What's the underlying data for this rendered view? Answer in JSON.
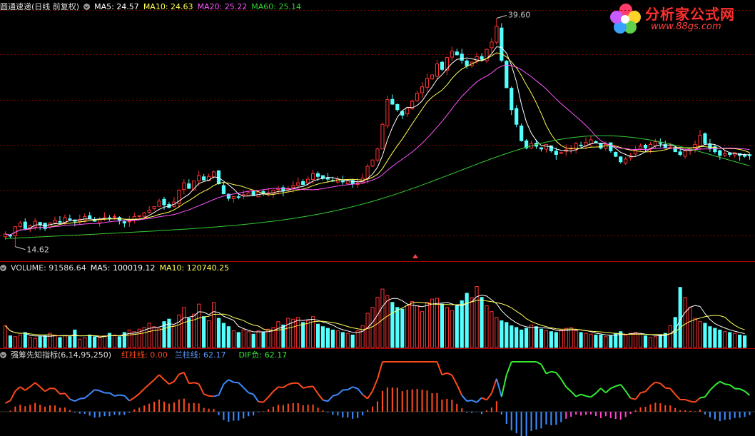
{
  "header": {
    "stock_title": "圆通速递(日线 前复权)",
    "ma5": "MA5: 24.57",
    "ma10": "MA10: 24.63",
    "ma20": "MA20: 25.22",
    "ma60": "MA60: 25.14"
  },
  "volume_header": {
    "volume": "VOLUME: 91586.64",
    "ma5": "MA5: 100019.12",
    "ma10": "MA10: 120740.25"
  },
  "indicator_header": {
    "name": "强筹先知指标(6,14,95,250)",
    "red": "红柱线: 0.00",
    "blue": "兰柱线: 62.17",
    "dif": "DIF负: 62.17"
  },
  "logo": {
    "title": "分析家公式网",
    "url": "www.88gs.com"
  },
  "annotations": {
    "high": "39.60",
    "low": "14.62"
  },
  "colors": {
    "up": "#ff3232",
    "down": "#54ffff",
    "ma5": "#ffffff",
    "ma10": "#ffff55",
    "ma20": "#ff55ff",
    "ma60": "#33cc33",
    "grid": "#8b0000",
    "ind_red": "#ff4a1c",
    "ind_blue": "#3c8cff",
    "ind_green": "#33ee33",
    "ind_pink": "#ff44cc"
  },
  "chart_data": [
    {
      "type": "candlestick",
      "title": "圆通速递(日线 前复权)",
      "price_range": [
        13.5,
        40.5
      ],
      "annotations": [
        {
          "label": "39.60",
          "value": 39.6
        },
        {
          "label": "14.62",
          "value": 14.62
        }
      ],
      "close": [
        16.0,
        15.8,
        16.8,
        17.2,
        16.6,
        16.9,
        17.4,
        17.0,
        16.6,
        17.2,
        17.5,
        17.3,
        17.8,
        17.6,
        17.4,
        17.6,
        17.9,
        17.7,
        17.4,
        17.6,
        17.8,
        17.7,
        17.9,
        17.5,
        17.2,
        17.4,
        17.9,
        18.0,
        18.3,
        18.6,
        19.0,
        19.6,
        19.2,
        18.9,
        19.5,
        20.8,
        21.6,
        21.0,
        21.8,
        22.4,
        21.9,
        22.3,
        22.8,
        21.5,
        20.4,
        19.9,
        20.1,
        20.0,
        20.3,
        20.5,
        20.2,
        20.6,
        20.4,
        20.5,
        20.8,
        21.0,
        20.7,
        21.0,
        21.3,
        21.6,
        21.4,
        22.0,
        22.6,
        22.3,
        22.1,
        22.0,
        21.8,
        22.0,
        21.7,
        21.8,
        21.5,
        21.6,
        22.1,
        23.4,
        24.1,
        25.3,
        28.0,
        30.7,
        30.2,
        29.6,
        29.0,
        29.8,
        30.5,
        31.4,
        32.1,
        33.0,
        33.4,
        34.6,
        34.0,
        35.3,
        36.0,
        35.6,
        35.0,
        34.4,
        34.8,
        35.4,
        35.1,
        36.2,
        37.0,
        38.7,
        35.0,
        32.0,
        29.6,
        28.0,
        26.2,
        25.4,
        25.9,
        25.6,
        25.3,
        25.8,
        25.1,
        24.7,
        24.9,
        25.2,
        25.4,
        25.9,
        25.7,
        26.0,
        26.3,
        26.0,
        25.4,
        25.8,
        25.1,
        24.5,
        23.9,
        24.2,
        24.6,
        25.2,
        25.6,
        25.4,
        25.8,
        26.1,
        25.9,
        25.4,
        25.5,
        25.0,
        24.7,
        25.1,
        25.4,
        25.8,
        26.8,
        25.9,
        25.4,
        25.0,
        24.6,
        24.8,
        24.7,
        24.9,
        24.6,
        24.5,
        24.57
      ]
    },
    {
      "type": "bar",
      "title": "VOLUME",
      "volume_range": [
        0,
        176000
      ],
      "values": [
        52000,
        28000,
        26000,
        30000,
        36000,
        24000,
        22000,
        26000,
        28000,
        34000,
        30000,
        24000,
        28000,
        26000,
        42000,
        20000,
        24000,
        30000,
        26000,
        24000,
        28000,
        34000,
        30000,
        26000,
        36000,
        42000,
        38000,
        44000,
        48000,
        58000,
        50000,
        46000,
        62000,
        68000,
        52000,
        78000,
        96000,
        70000,
        80000,
        104000,
        74000,
        64000,
        108000,
        70000,
        58000,
        50000,
        40000,
        36000,
        42000,
        38000,
        32000,
        40000,
        36000,
        44000,
        48000,
        62000,
        54000,
        70000,
        68000,
        72000,
        60000,
        64000,
        74000,
        56000,
        50000,
        46000,
        42000,
        40000,
        36000,
        34000,
        30000,
        40000,
        52000,
        82000,
        96000,
        120000,
        140000,
        124000,
        108000,
        96000,
        92000,
        100000,
        110000,
        100000,
        86000,
        108000,
        116000,
        118000,
        104000,
        96000,
        88000,
        100000,
        112000,
        130000,
        120000,
        146000,
        120000,
        100000,
        86000,
        72000,
        64000,
        60000,
        52000,
        48000,
        42000,
        46000,
        54000,
        50000,
        44000,
        40000,
        38000,
        36000,
        42000,
        46000,
        48000,
        40000,
        36000,
        34000,
        32000,
        30000,
        30000,
        26000,
        28000,
        34000,
        38000,
        30000,
        34000,
        36000,
        32000,
        28000,
        24000,
        26000,
        30000,
        34000,
        52000,
        72000,
        144000,
        120000,
        96000,
        70000,
        62000,
        58000,
        50000,
        46000,
        42000,
        38000,
        36000,
        34000,
        30000,
        28000
      ]
    },
    {
      "type": "bar",
      "title": "强筹先知指标(6,14,95,250)",
      "series": [
        {
          "name": "红柱线",
          "value": 0.0
        },
        {
          "name": "兰柱线",
          "value": 62.17
        },
        {
          "name": "DIF负",
          "value": 62.17
        }
      ]
    }
  ]
}
